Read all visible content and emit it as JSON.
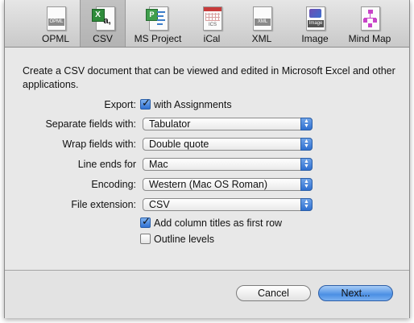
{
  "toolbar": {
    "items": [
      {
        "label": "OPML",
        "icon": "opml-document-icon",
        "tag": "OPML"
      },
      {
        "label": "CSV",
        "icon": "csv-excel-icon",
        "tag": "a,"
      },
      {
        "label": "MS Project",
        "icon": "ms-project-icon",
        "tag": ""
      },
      {
        "label": "iCal",
        "icon": "ical-document-icon",
        "tag": "ICS"
      },
      {
        "label": "XML",
        "icon": "xml-document-icon",
        "tag": "XML"
      },
      {
        "label": "Image",
        "icon": "image-document-icon",
        "tag": "Image"
      },
      {
        "label": "Mind Map",
        "icon": "mind-map-icon",
        "tag": ""
      }
    ],
    "selected": "CSV"
  },
  "main": {
    "description": "Create a CSV document that can be viewed and edited in Microsoft Excel and other applications.",
    "export": {
      "label": "Export:",
      "checkbox_label": "with Assignments",
      "checked": true
    },
    "separate": {
      "label": "Separate fields with:",
      "value": "Tabulator"
    },
    "wrap": {
      "label": "Wrap fields with:",
      "value": "Double quote"
    },
    "line_ends": {
      "label": "Line ends for",
      "value": "Mac"
    },
    "encoding": {
      "label": "Encoding:",
      "value": "Western (Mac OS Roman)"
    },
    "extension": {
      "label": "File extension:",
      "value": "CSV"
    },
    "column_titles": {
      "label": "Add column titles as first row",
      "checked": true
    },
    "outline_levels": {
      "label": "Outline levels",
      "checked": false
    }
  },
  "buttons": {
    "cancel": "Cancel",
    "next": "Next..."
  },
  "colors": {
    "accent": "#2f70d2",
    "window_bg": "#e8e8e8"
  }
}
